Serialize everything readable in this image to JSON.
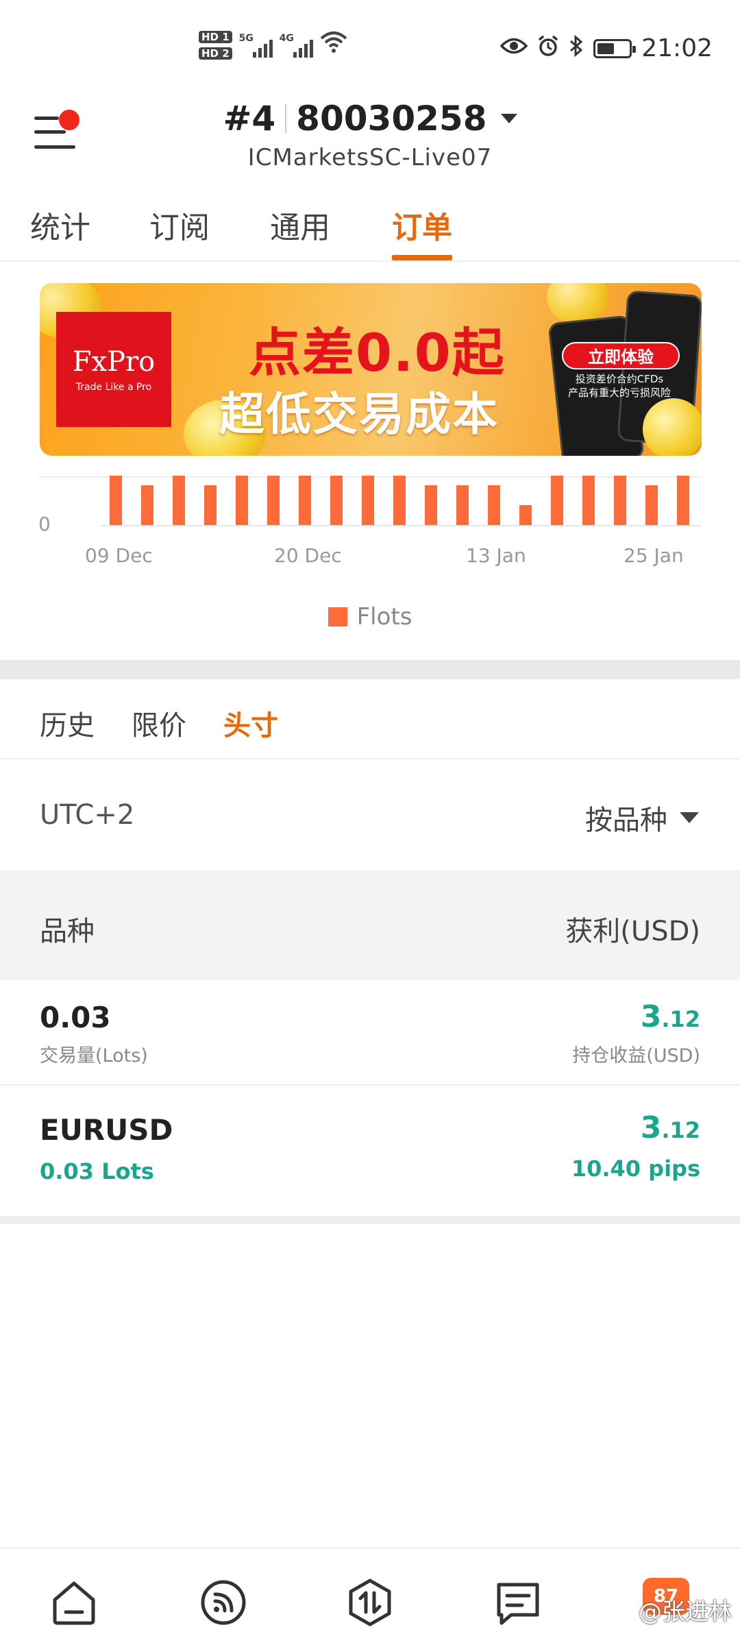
{
  "status_bar": {
    "sim1": "HD 1",
    "sim2": "HD 2",
    "net1": "5G",
    "net2": "4G",
    "time": "21:02",
    "battery_level": 0.55,
    "icons": [
      "eye-icon",
      "alarm-icon",
      "bluetooth-icon",
      "battery-icon",
      "wifi-icon"
    ]
  },
  "header": {
    "account_index": "#4",
    "account_number": "80030258",
    "server": "ICMarketsSC-Live07"
  },
  "tabs": [
    {
      "label": "统计",
      "active": false
    },
    {
      "label": "订阅",
      "active": false
    },
    {
      "label": "通用",
      "active": false
    },
    {
      "label": "订单",
      "active": true
    }
  ],
  "banner": {
    "brand": "FxPro",
    "brand_tagline": "Trade Like a Pro",
    "headline": "点差0.0起",
    "subheadline": "超低交易成本",
    "cta": "立即体验",
    "note_line1": "投资差价合约CFDs",
    "note_line2": "产品有重大的亏损风险"
  },
  "chart_data": {
    "type": "bar",
    "y_tick_label": "0",
    "x_tick_labels": [
      "09 Dec",
      "20 Dec",
      "13 Jan",
      "25 Jan"
    ],
    "series": [
      {
        "name": "Flots",
        "values": [
          1.0,
          0.8,
          1.0,
          0.8,
          1.0,
          1.0,
          1.0,
          1.0,
          1.0,
          1.0,
          0.8,
          0.8,
          0.8,
          0.4,
          1.0,
          1.0,
          1.0,
          0.8,
          1.0
        ]
      }
    ],
    "color": "#fe6b3b",
    "legend_position": "bottom"
  },
  "sub_tabs": [
    {
      "label": "历史",
      "active": false
    },
    {
      "label": "限价",
      "active": false
    },
    {
      "label": "头寸",
      "active": true
    }
  ],
  "filter": {
    "timezone": "UTC+2",
    "sort_label": "按品种"
  },
  "table": {
    "col_symbol": "品种",
    "col_profit": "获利(USD)"
  },
  "summary": {
    "volume": "0.03",
    "volume_label": "交易量(Lots)",
    "profit_int": "3",
    "profit_dec": ".12",
    "profit_label": "持仓收益(USD)"
  },
  "positions": [
    {
      "symbol": "EURUSD",
      "lots": "0.03 Lots",
      "profit_int": "3",
      "profit_dec": ".12",
      "pips": "10.40 pips"
    }
  ],
  "bottom_nav": {
    "items": [
      "home-icon",
      "signal-icon",
      "trade-icon",
      "chat-icon"
    ],
    "badge": "87",
    "watermark": "@张进林"
  },
  "colors": {
    "accent": "#e8690c",
    "profit": "#1aa58d",
    "bar": "#fe6b3b"
  }
}
